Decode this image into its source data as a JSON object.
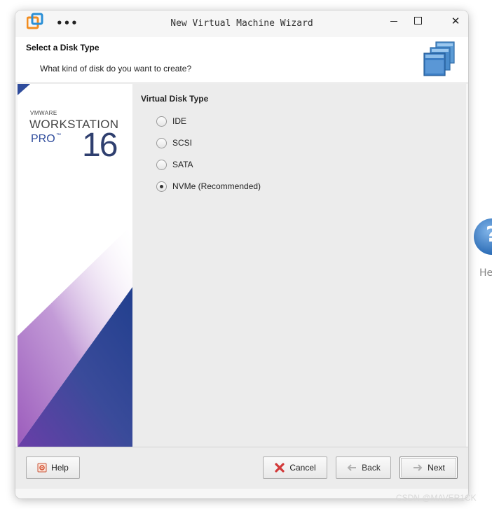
{
  "window": {
    "title": "New Virtual Machine Wizard",
    "menu_label": "•••",
    "close_label": "✕"
  },
  "header": {
    "title": "Select a Disk Type",
    "subtitle": "What kind of disk do you want to create?"
  },
  "banner": {
    "vmware": "VMWARE",
    "product": "WORKSTATION",
    "edition": "PRO",
    "tm": "™",
    "version": "16"
  },
  "disk_type": {
    "label": "Virtual Disk Type",
    "options": [
      {
        "label": "IDE",
        "checked": false
      },
      {
        "label": "SCSI",
        "checked": false
      },
      {
        "label": "SATA",
        "checked": false
      },
      {
        "label": "NVMe (Recommended)",
        "checked": true
      }
    ]
  },
  "footer": {
    "help_label": "Help",
    "cancel_label": "Cancel",
    "back_label": "Back",
    "next_label": "Next"
  },
  "background": {
    "help_glyph": "?",
    "help_label": "He"
  },
  "watermark": "CSDN @MAVER1CK",
  "colors": {
    "brand_blue": "#2f4c9c",
    "banner_purple": "#7a3fa0",
    "cancel_red": "#d23a3a"
  }
}
